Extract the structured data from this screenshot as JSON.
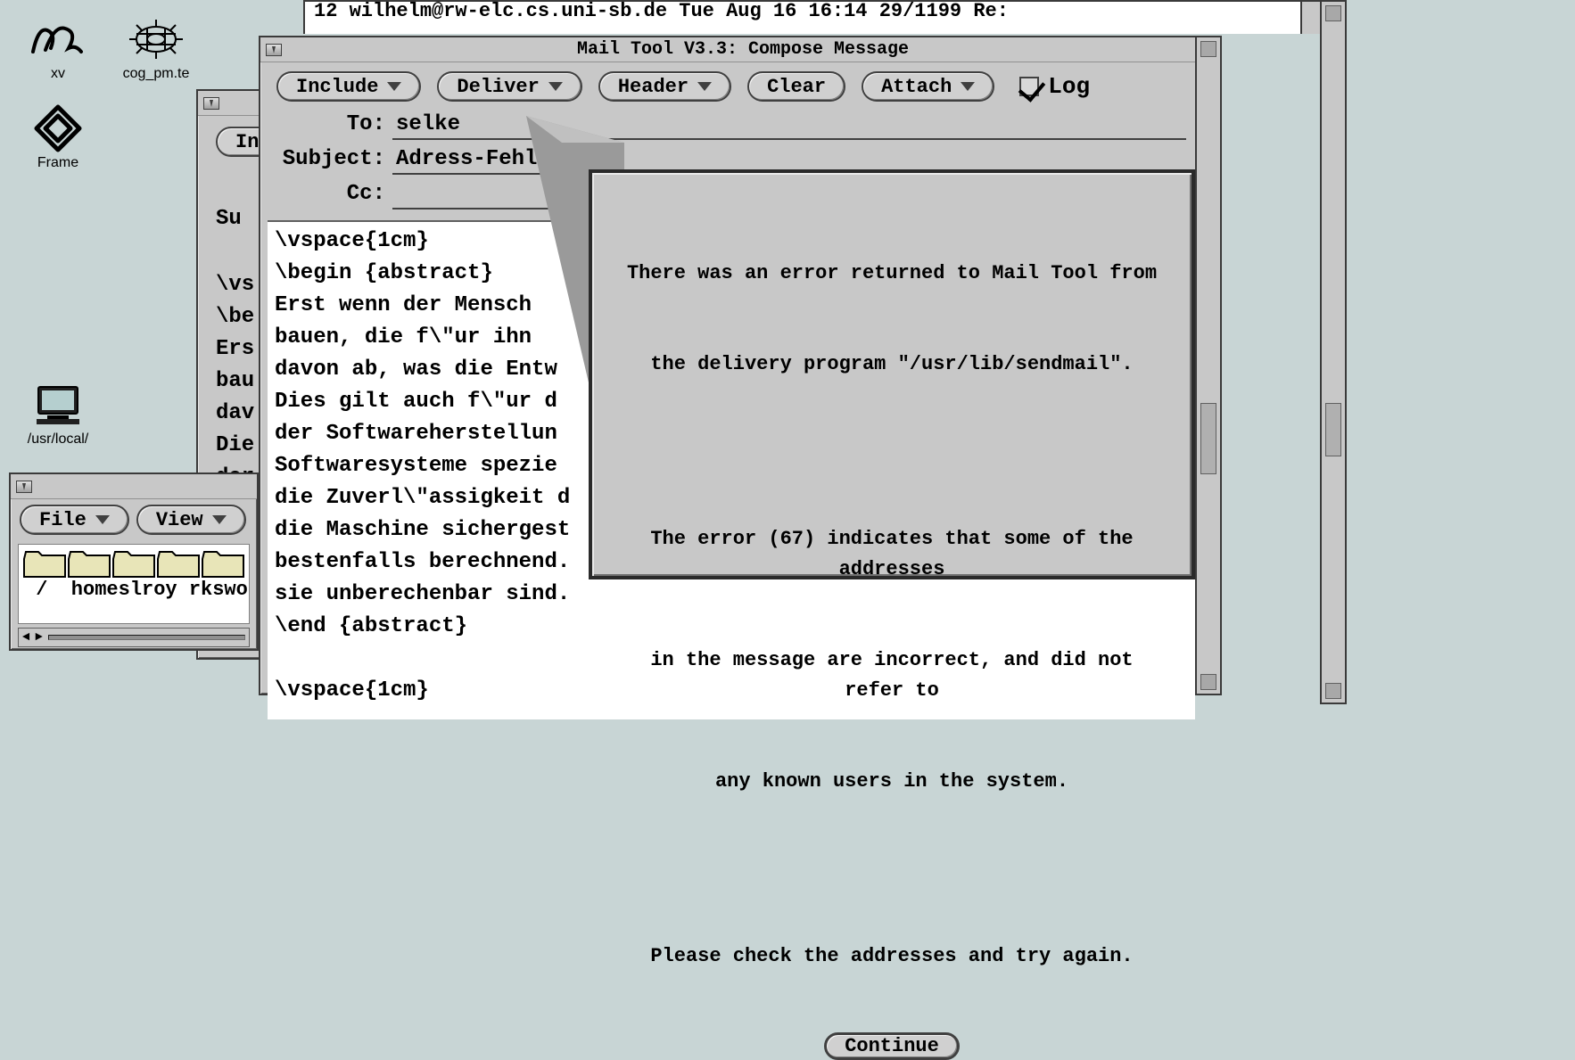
{
  "desktop": {
    "icons": {
      "xv": {
        "label": "xv"
      },
      "cog": {
        "label": "cog_pm.te"
      },
      "frame": {
        "label": "Frame"
      },
      "usr": {
        "label": "/usr/local/"
      }
    }
  },
  "mail_list_strip": {
    "line": "12 wilhelm@rw-elc.cs.uni-sb.de Tue Aug 16 16:14   29/1199   Re:"
  },
  "back_window": {
    "include_btn": "In",
    "subject_label": "Su",
    "body_fragment": "\\vs\n\\be\nErs\nbau\ndav\nDie\nder"
  },
  "file_manager": {
    "buttons": {
      "file": "File",
      "view": "View"
    },
    "path_labels": [
      "/",
      "homes",
      "lroy",
      "rks",
      "wo"
    ],
    "path_row": " /  homeslroy rkswo"
  },
  "compose": {
    "title": "Mail Tool V3.3: Compose Message",
    "buttons": {
      "include": "Include",
      "deliver": "Deliver",
      "header": "Header",
      "clear": "Clear",
      "attach": "Attach"
    },
    "log_label": "Log",
    "log_checked": true,
    "headers": {
      "to_label": "To:",
      "to_value": "selke",
      "subject_label": "Subject:",
      "subject_value": "Adress-Fehl",
      "cc_label": "Cc:",
      "cc_value": ""
    },
    "body": "\\vspace{1cm}\n\\begin {abstract}\nErst wenn der Mensch \nbauen, die f\\\"ur ihn \ndavon ab, was die Entw\nDies gilt auch f\\\"ur d\nder Softwareherstellun\nSoftwaresysteme spezie\ndie Zuverl\\\"assigkeit d\ndie Maschine sichergest\nbestenfalls berechnend.\nsie unberechenbar sind.\n\\end {abstract}\n\n\\vspace{1cm}"
  },
  "error_dialog": {
    "line1": "There was an error returned to Mail Tool from",
    "line2": "the delivery program \"/usr/lib/sendmail\".",
    "line3": "The error (67) indicates that some of the addresses",
    "line4": "in the message are incorrect, and did not refer to",
    "line5": "any known users in the system.",
    "line6": "Please check the addresses and try again.",
    "continue": "Continue"
  }
}
